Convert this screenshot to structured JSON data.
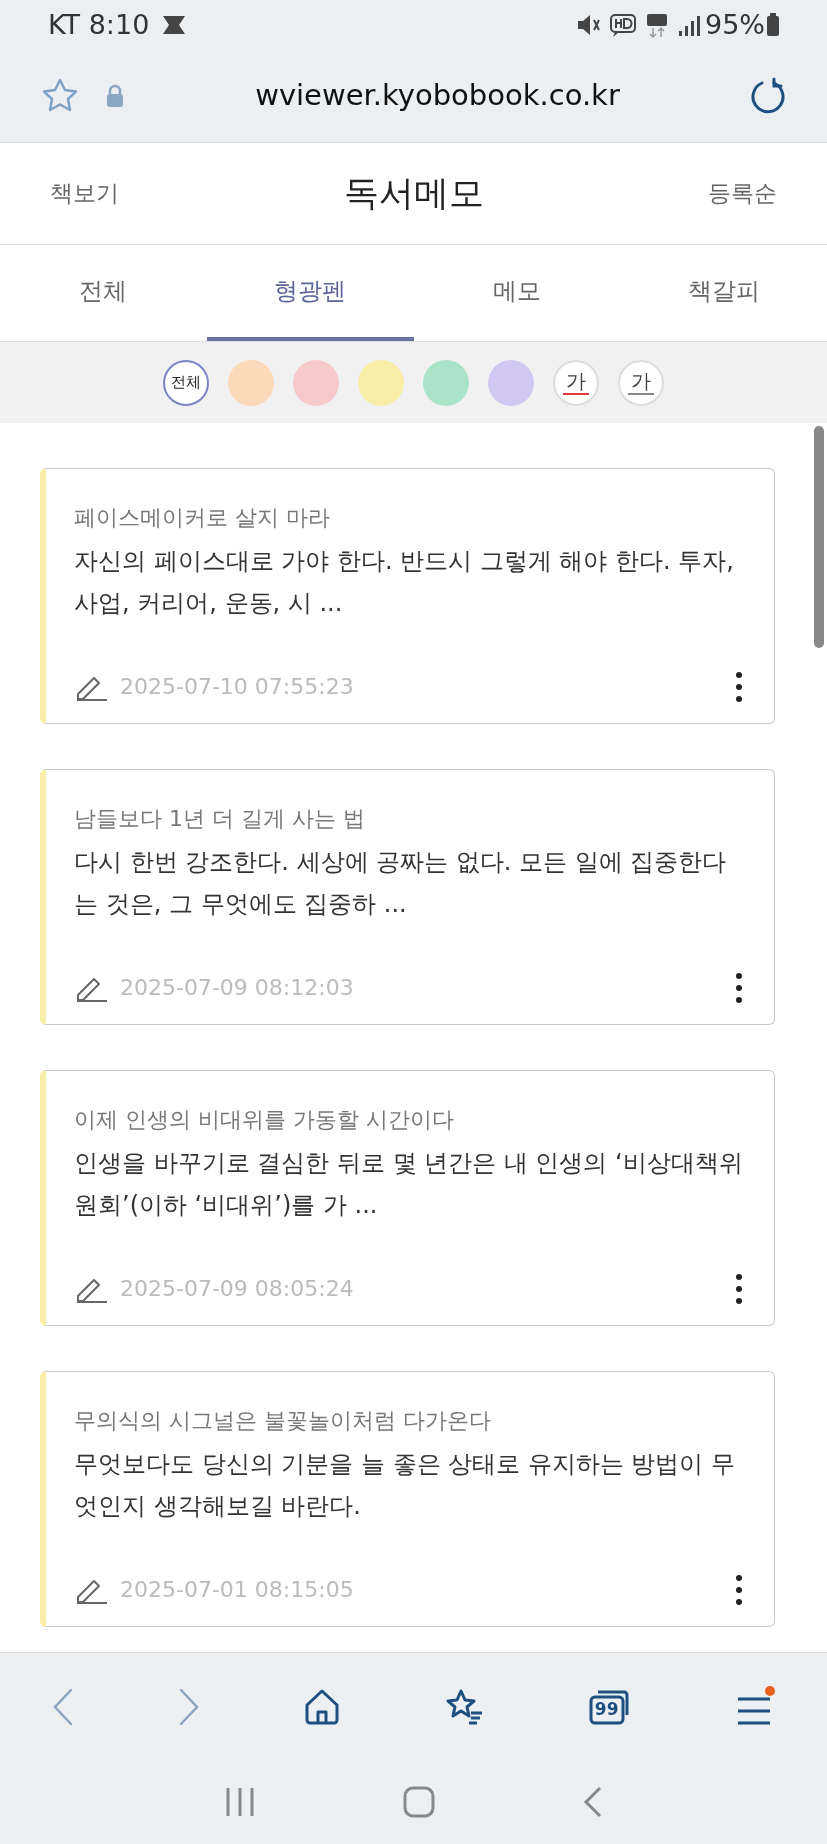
{
  "status_bar": {
    "carrier_time": "KT 8:10",
    "battery": "95%"
  },
  "browser": {
    "url": "wviewer.kyobobook.co.kr"
  },
  "header": {
    "left": "책보기",
    "title": "독서메모",
    "right": "등록순"
  },
  "tabs": [
    {
      "label": "전체",
      "selected": false
    },
    {
      "label": "형광펜",
      "selected": true
    },
    {
      "label": "메모",
      "selected": false
    },
    {
      "label": "책갈피",
      "selected": false
    }
  ],
  "filters": [
    {
      "kind": "all",
      "label": "전체",
      "selected": true
    },
    {
      "kind": "color",
      "color": "#fcd9b8",
      "selected": false
    },
    {
      "kind": "color",
      "color": "#f7c9cb",
      "selected": false
    },
    {
      "kind": "color",
      "color": "#f8eea8",
      "selected": false
    },
    {
      "kind": "color",
      "color": "#a9e3c8",
      "selected": false
    },
    {
      "kind": "color",
      "color": "#d0c8f2",
      "selected": false
    },
    {
      "kind": "underline",
      "label": "가",
      "color": "#e03a3a",
      "selected": false
    },
    {
      "kind": "underline",
      "label": "가",
      "color": "#888888",
      "selected": false
    }
  ],
  "notes": [
    {
      "title": "페이스메이커로 살지 마라",
      "text": "자신의 페이스대로 가야 한다. 반드시 그렇게 해야 한다. 투자, 사업, 커리어, 운동, 시 ...",
      "date": "2025-07-10 07:55:23",
      "color": "#f8eea8"
    },
    {
      "title": "남들보다 1년 더 길게 사는 법",
      "text": "다시 한번 강조한다. 세상에 공짜는 없다. 모든 일에 집중한다는 것은, 그 무엇에도 집중하 ...",
      "date": "2025-07-09 08:12:03",
      "color": "#f8eea8"
    },
    {
      "title": "이제 인생의 비대위를 가동할 시간이다",
      "text": "인생을 바꾸기로 결심한 뒤로 몇 년간은 내 인생의 ‘비상대책위원회’(이하 ‘비대위’)를 가 ...",
      "date": "2025-07-09 08:05:24",
      "color": "#f8eea8"
    },
    {
      "title": "무의식의 시그널은 불꽃놀이처럼 다가온다",
      "text": "무엇보다도 당신의 기분을 늘 좋은 상태로 유지하는 방법이 무엇인지 생각해보길 바란다.",
      "date": "2025-07-01 08:15:05",
      "color": "#f8eea8"
    }
  ],
  "bottom_nav": {
    "tabs_count": "99"
  }
}
